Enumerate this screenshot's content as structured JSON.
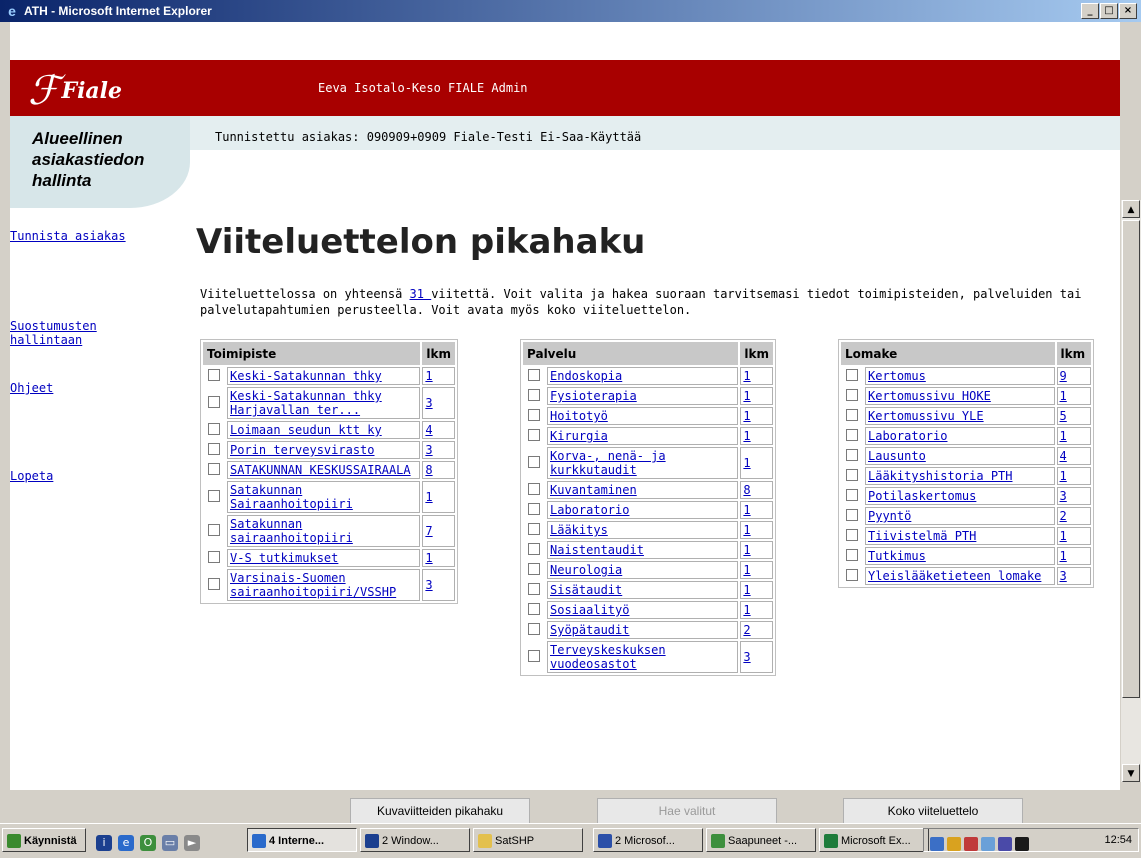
{
  "window": {
    "title": "ATH - Microsoft Internet Explorer",
    "min": "_",
    "max": "□",
    "close": "×"
  },
  "header": {
    "logo": "Fiale",
    "user": "Eeva Isotalo-Keso FIALE Admin",
    "identified": "Tunnistettu asiakas: 090909+0909 Fiale-Testi Ei-Saa-Käyttää"
  },
  "side": {
    "title": "Alueellinen asiakastiedon hallinta",
    "nav": [
      "Tunnista asiakas",
      "Suostumusten hallintaan",
      "Ohjeet",
      "Lopeta"
    ]
  },
  "main": {
    "title": "Viiteluettelon pikahaku",
    "intro_prefix": "Viiteluettelossa on yhteensä ",
    "intro_link": "31 ",
    "intro_suffix": "viitettä. Voit valita ja hakea suoraan tarvitsemasi tiedot toimipisteiden, palveluiden tai palvelutapahtumien perusteella. Voit avata myös koko viiteluettelon."
  },
  "tables": [
    {
      "head": "Toimipiste",
      "count_head": "lkm",
      "rows": [
        {
          "name": "Keski-Satakunnan thky",
          "n": "1"
        },
        {
          "name": "Keski-Satakunnan thky Harjavallan ter...",
          "n": "3"
        },
        {
          "name": "Loimaan seudun ktt ky",
          "n": "4"
        },
        {
          "name": "Porin terveysvirasto",
          "n": "3"
        },
        {
          "name": "SATAKUNNAN KESKUSSAIRAALA",
          "n": "8"
        },
        {
          "name": "Satakunnan Sairaanhoitopiiri",
          "n": "1"
        },
        {
          "name": "Satakunnan sairaanhoitopiiri",
          "n": "7"
        },
        {
          "name": "V-S tutkimukset",
          "n": "1"
        },
        {
          "name": "Varsinais-Suomen sairaanhoitopiiri/VSSHP",
          "n": "3"
        }
      ]
    },
    {
      "head": "Palvelu",
      "count_head": "lkm",
      "rows": [
        {
          "name": "Endoskopia",
          "n": "1"
        },
        {
          "name": "Fysioterapia",
          "n": "1"
        },
        {
          "name": "Hoitotyö",
          "n": "1"
        },
        {
          "name": "Kirurgia",
          "n": "1"
        },
        {
          "name": "Korva-, nenä- ja kurkkutaudit",
          "n": "1"
        },
        {
          "name": "Kuvantaminen",
          "n": "8"
        },
        {
          "name": "Laboratorio",
          "n": "1"
        },
        {
          "name": "Lääkitys",
          "n": "1"
        },
        {
          "name": "Naistentaudit",
          "n": "1"
        },
        {
          "name": "Neurologia",
          "n": "1"
        },
        {
          "name": "Sisätaudit",
          "n": "1"
        },
        {
          "name": "Sosiaalityö",
          "n": "1"
        },
        {
          "name": "Syöpätaudit",
          "n": "2"
        },
        {
          "name": "Terveyskeskuksen vuodeosastot",
          "n": "3"
        }
      ]
    },
    {
      "head": "Lomake",
      "count_head": "lkm",
      "rows": [
        {
          "name": "Kertomus",
          "n": "9"
        },
        {
          "name": "Kertomussivu HOKE",
          "n": "1"
        },
        {
          "name": "Kertomussivu YLE",
          "n": "5"
        },
        {
          "name": "Laboratorio",
          "n": "1"
        },
        {
          "name": "Lausunto",
          "n": "4"
        },
        {
          "name": "Lääkityshistoria PTH",
          "n": "1"
        },
        {
          "name": "Potilaskertomus",
          "n": "3"
        },
        {
          "name": "Pyyntö",
          "n": "2"
        },
        {
          "name": "Tiivistelmä PTH",
          "n": "1"
        },
        {
          "name": "Tutkimus",
          "n": "1"
        },
        {
          "name": "Yleislääketieteen lomake",
          "n": "3"
        }
      ]
    }
  ],
  "buttons": {
    "quick_images": "Kuvaviitteiden pikahaku",
    "fetch_selected": "Hae valitut",
    "full_list": "Koko viiteluettelo"
  },
  "taskbar": {
    "start": "Käynnistä",
    "items": [
      "4 Interne...",
      "2 Window...",
      "SatSHP",
      "2 Microsof...",
      "Saapuneet -...",
      "Microsoft Ex..."
    ],
    "clock": "12:54"
  }
}
